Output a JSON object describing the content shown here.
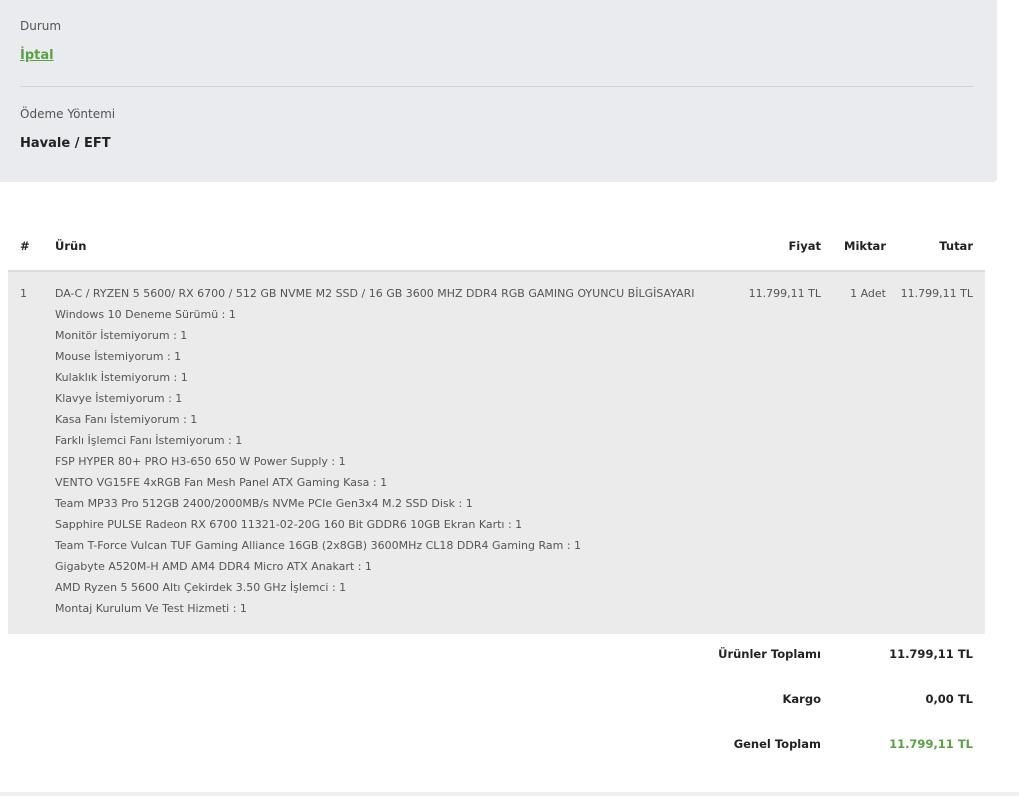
{
  "order_info": {
    "status_label": "Durum",
    "status_value": "İptal",
    "payment_label": "Ödeme Yöntemi",
    "payment_value": "Havale / EFT"
  },
  "table": {
    "headers": {
      "index": "#",
      "product": "Ürün",
      "price": "Fiyat",
      "quantity": "Miktar",
      "total": "Tutar"
    },
    "rows": [
      {
        "index": "1",
        "product": "DA-C / RYZEN 5 5600/ RX 6700 / 512 GB NVME M2 SSD / 16 GB 3600 MHZ DDR4 RGB GAMING OYUNCU BİLGİSAYARI",
        "price": "11.799,11 TL",
        "quantity": "1 Adet",
        "total": "11.799,11 TL",
        "options": [
          "Windows 10 Deneme Sürümü : 1",
          "Monitör İstemiyorum : 1",
          "Mouse İstemiyorum : 1",
          "Kulaklık İstemiyorum : 1",
          "Klavye İstemiyorum : 1",
          "Kasa Fanı İstemiyorum : 1",
          "Farklı İşlemci Fanı İstemiyorum : 1",
          "FSP HYPER 80+ PRO H3-650 650 W Power Supply : 1",
          "VENTO VG15FE 4xRGB Fan Mesh Panel ATX Gaming Kasa : 1",
          "Team MP33 Pro 512GB 2400/2000MB/s NVMe PCIe Gen3x4 M.2 SSD Disk : 1",
          "Sapphire PULSE Radeon RX 6700 11321-02-20G 160 Bit GDDR6 10GB Ekran Kartı : 1",
          "Team T-Force Vulcan TUF Gaming Alliance 16GB (2x8GB) 3600MHz CL18 DDR4 Gaming Ram : 1",
          "Gigabyte A520M-H AMD AM4 DDR4 Micro ATX Anakart : 1",
          "AMD Ryzen 5 5600 Altı Çekirdek 3.50 GHz İşlemci : 1",
          "Montaj Kurulum Ve Test Hizmeti : 1"
        ]
      }
    ]
  },
  "summary": {
    "products_total_label": "Ürünler Toplamı",
    "products_total_value": "11.799,11 TL",
    "shipping_label": "Kargo",
    "shipping_value": "0,00 TL",
    "grand_total_label": "Genel Toplam",
    "grand_total_value": "11.799,11 TL",
    "accent_color": "#56a33f"
  }
}
